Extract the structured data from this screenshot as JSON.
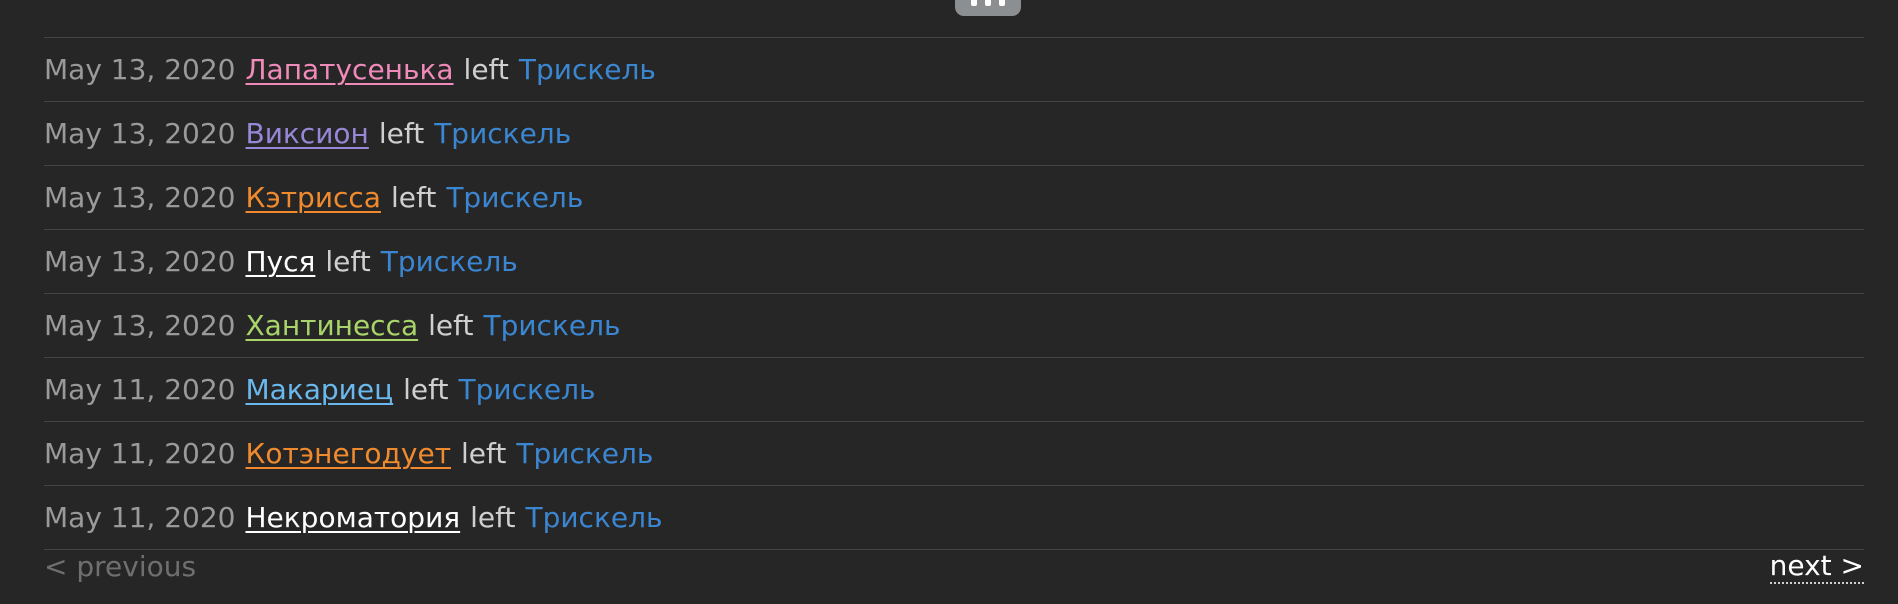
{
  "top_badge": {
    "icon": "avatar-badge-icon"
  },
  "log": [
    {
      "date": "May 13, 2020",
      "user": "Лапатусенька",
      "user_color": "#f08ab8",
      "action": "left",
      "group": "Трискель",
      "group_color": "#3b86d1"
    },
    {
      "date": "May 13, 2020",
      "user": "Виксион",
      "user_color": "#9787d6",
      "action": "left",
      "group": "Трискель",
      "group_color": "#3b86d1"
    },
    {
      "date": "May 13, 2020",
      "user": "Кэтрисса",
      "user_color": "#f08a2e",
      "action": "left",
      "group": "Трискель",
      "group_color": "#3b86d1"
    },
    {
      "date": "May 13, 2020",
      "user": "Пуся",
      "user_color": "#ffffff",
      "action": "left",
      "group": "Трискель",
      "group_color": "#3b86d1"
    },
    {
      "date": "May 13, 2020",
      "user": "Хантинесса",
      "user_color": "#a9d46a",
      "action": "left",
      "group": "Трискель",
      "group_color": "#3b86d1"
    },
    {
      "date": "May 11, 2020",
      "user": "Макариец",
      "user_color": "#6bb8ee",
      "action": "left",
      "group": "Трискель",
      "group_color": "#3b86d1"
    },
    {
      "date": "May 11, 2020",
      "user": "Котэнегодует",
      "user_color": "#f08a2e",
      "action": "left",
      "group": "Трискель",
      "group_color": "#3b86d1"
    },
    {
      "date": "May 11, 2020",
      "user": "Некроматория",
      "user_color": "#ffffff",
      "action": "left",
      "group": "Трискель",
      "group_color": "#3b86d1"
    }
  ],
  "pager": {
    "previous_label": "< previous",
    "next_label": "next >"
  }
}
